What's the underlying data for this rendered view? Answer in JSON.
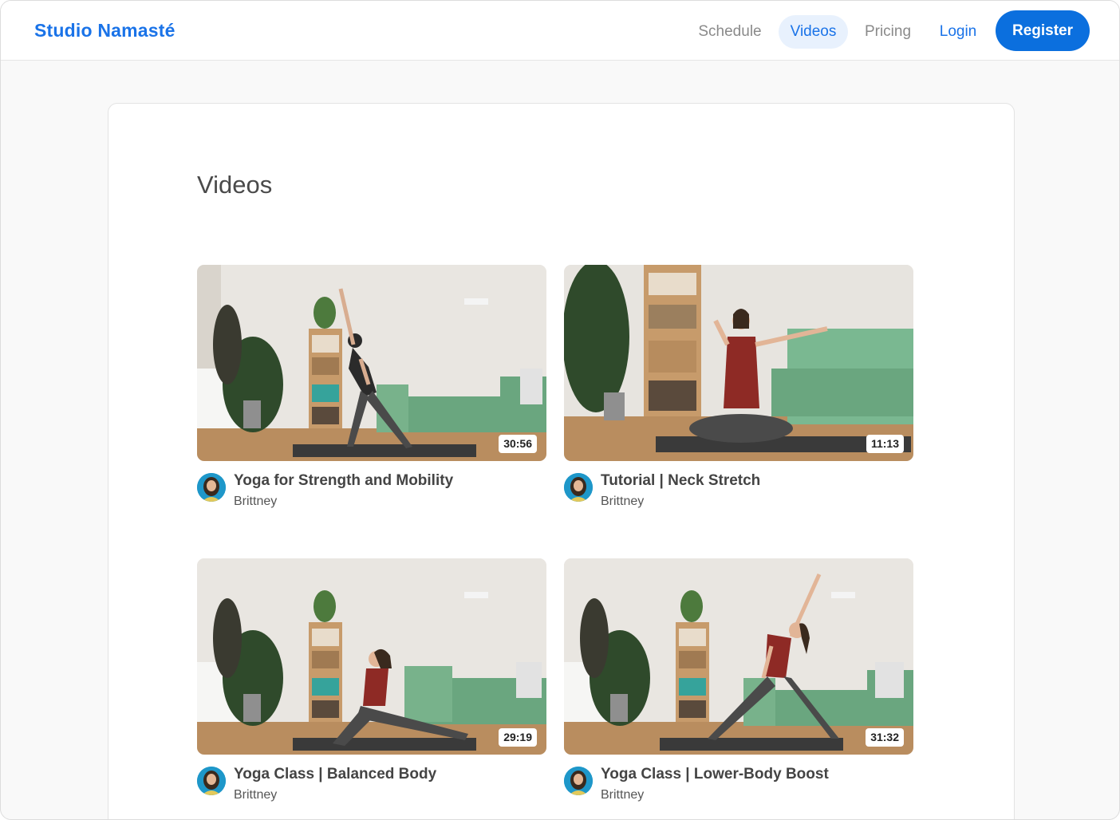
{
  "header": {
    "brand": "Studio Namasté",
    "nav": {
      "schedule": "Schedule",
      "videos": "Videos",
      "pricing": "Pricing",
      "login": "Login",
      "register": "Register"
    },
    "active_tab": "Videos",
    "accent_color": "#1a73e8"
  },
  "main": {
    "title": "Videos",
    "videos": [
      {
        "title": "Yoga for Strength and Mobility",
        "author": "Brittney",
        "duration": "30:56",
        "shirt_color": "#2b2b2b"
      },
      {
        "title": "Tutorial | Neck Stretch",
        "author": "Brittney",
        "duration": "11:13",
        "shirt_color": "#8e2a25"
      },
      {
        "title": "Yoga Class | Balanced Body",
        "author": "Brittney",
        "duration": "29:19",
        "shirt_color": "#8e2a25"
      },
      {
        "title": "Yoga Class | Lower-Body Boost",
        "author": "Brittney",
        "duration": "31:32",
        "shirt_color": "#8e2a25"
      }
    ]
  }
}
